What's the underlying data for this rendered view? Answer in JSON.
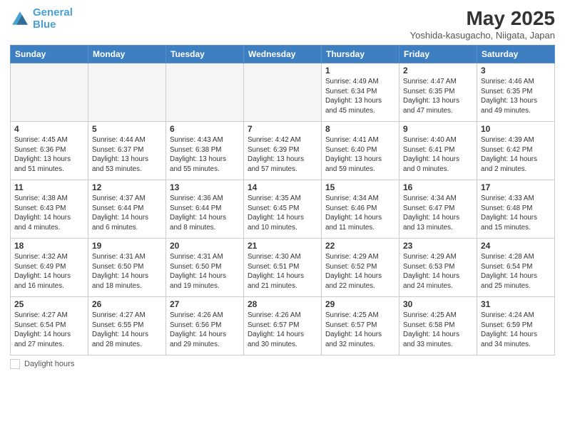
{
  "header": {
    "logo_line1": "General",
    "logo_line2": "Blue",
    "month": "May 2025",
    "location": "Yoshida-kasugacho, Niigata, Japan"
  },
  "weekdays": [
    "Sunday",
    "Monday",
    "Tuesday",
    "Wednesday",
    "Thursday",
    "Friday",
    "Saturday"
  ],
  "footer_legend": "Daylight hours",
  "weeks": [
    [
      {
        "day": "",
        "info": ""
      },
      {
        "day": "",
        "info": ""
      },
      {
        "day": "",
        "info": ""
      },
      {
        "day": "",
        "info": ""
      },
      {
        "day": "1",
        "info": "Sunrise: 4:49 AM\nSunset: 6:34 PM\nDaylight: 13 hours\nand 45 minutes."
      },
      {
        "day": "2",
        "info": "Sunrise: 4:47 AM\nSunset: 6:35 PM\nDaylight: 13 hours\nand 47 minutes."
      },
      {
        "day": "3",
        "info": "Sunrise: 4:46 AM\nSunset: 6:35 PM\nDaylight: 13 hours\nand 49 minutes."
      }
    ],
    [
      {
        "day": "4",
        "info": "Sunrise: 4:45 AM\nSunset: 6:36 PM\nDaylight: 13 hours\nand 51 minutes."
      },
      {
        "day": "5",
        "info": "Sunrise: 4:44 AM\nSunset: 6:37 PM\nDaylight: 13 hours\nand 53 minutes."
      },
      {
        "day": "6",
        "info": "Sunrise: 4:43 AM\nSunset: 6:38 PM\nDaylight: 13 hours\nand 55 minutes."
      },
      {
        "day": "7",
        "info": "Sunrise: 4:42 AM\nSunset: 6:39 PM\nDaylight: 13 hours\nand 57 minutes."
      },
      {
        "day": "8",
        "info": "Sunrise: 4:41 AM\nSunset: 6:40 PM\nDaylight: 13 hours\nand 59 minutes."
      },
      {
        "day": "9",
        "info": "Sunrise: 4:40 AM\nSunset: 6:41 PM\nDaylight: 14 hours\nand 0 minutes."
      },
      {
        "day": "10",
        "info": "Sunrise: 4:39 AM\nSunset: 6:42 PM\nDaylight: 14 hours\nand 2 minutes."
      }
    ],
    [
      {
        "day": "11",
        "info": "Sunrise: 4:38 AM\nSunset: 6:43 PM\nDaylight: 14 hours\nand 4 minutes."
      },
      {
        "day": "12",
        "info": "Sunrise: 4:37 AM\nSunset: 6:44 PM\nDaylight: 14 hours\nand 6 minutes."
      },
      {
        "day": "13",
        "info": "Sunrise: 4:36 AM\nSunset: 6:44 PM\nDaylight: 14 hours\nand 8 minutes."
      },
      {
        "day": "14",
        "info": "Sunrise: 4:35 AM\nSunset: 6:45 PM\nDaylight: 14 hours\nand 10 minutes."
      },
      {
        "day": "15",
        "info": "Sunrise: 4:34 AM\nSunset: 6:46 PM\nDaylight: 14 hours\nand 11 minutes."
      },
      {
        "day": "16",
        "info": "Sunrise: 4:34 AM\nSunset: 6:47 PM\nDaylight: 14 hours\nand 13 minutes."
      },
      {
        "day": "17",
        "info": "Sunrise: 4:33 AM\nSunset: 6:48 PM\nDaylight: 14 hours\nand 15 minutes."
      }
    ],
    [
      {
        "day": "18",
        "info": "Sunrise: 4:32 AM\nSunset: 6:49 PM\nDaylight: 14 hours\nand 16 minutes."
      },
      {
        "day": "19",
        "info": "Sunrise: 4:31 AM\nSunset: 6:50 PM\nDaylight: 14 hours\nand 18 minutes."
      },
      {
        "day": "20",
        "info": "Sunrise: 4:31 AM\nSunset: 6:50 PM\nDaylight: 14 hours\nand 19 minutes."
      },
      {
        "day": "21",
        "info": "Sunrise: 4:30 AM\nSunset: 6:51 PM\nDaylight: 14 hours\nand 21 minutes."
      },
      {
        "day": "22",
        "info": "Sunrise: 4:29 AM\nSunset: 6:52 PM\nDaylight: 14 hours\nand 22 minutes."
      },
      {
        "day": "23",
        "info": "Sunrise: 4:29 AM\nSunset: 6:53 PM\nDaylight: 14 hours\nand 24 minutes."
      },
      {
        "day": "24",
        "info": "Sunrise: 4:28 AM\nSunset: 6:54 PM\nDaylight: 14 hours\nand 25 minutes."
      }
    ],
    [
      {
        "day": "25",
        "info": "Sunrise: 4:27 AM\nSunset: 6:54 PM\nDaylight: 14 hours\nand 27 minutes."
      },
      {
        "day": "26",
        "info": "Sunrise: 4:27 AM\nSunset: 6:55 PM\nDaylight: 14 hours\nand 28 minutes."
      },
      {
        "day": "27",
        "info": "Sunrise: 4:26 AM\nSunset: 6:56 PM\nDaylight: 14 hours\nand 29 minutes."
      },
      {
        "day": "28",
        "info": "Sunrise: 4:26 AM\nSunset: 6:57 PM\nDaylight: 14 hours\nand 30 minutes."
      },
      {
        "day": "29",
        "info": "Sunrise: 4:25 AM\nSunset: 6:57 PM\nDaylight: 14 hours\nand 32 minutes."
      },
      {
        "day": "30",
        "info": "Sunrise: 4:25 AM\nSunset: 6:58 PM\nDaylight: 14 hours\nand 33 minutes."
      },
      {
        "day": "31",
        "info": "Sunrise: 4:24 AM\nSunset: 6:59 PM\nDaylight: 14 hours\nand 34 minutes."
      }
    ]
  ]
}
